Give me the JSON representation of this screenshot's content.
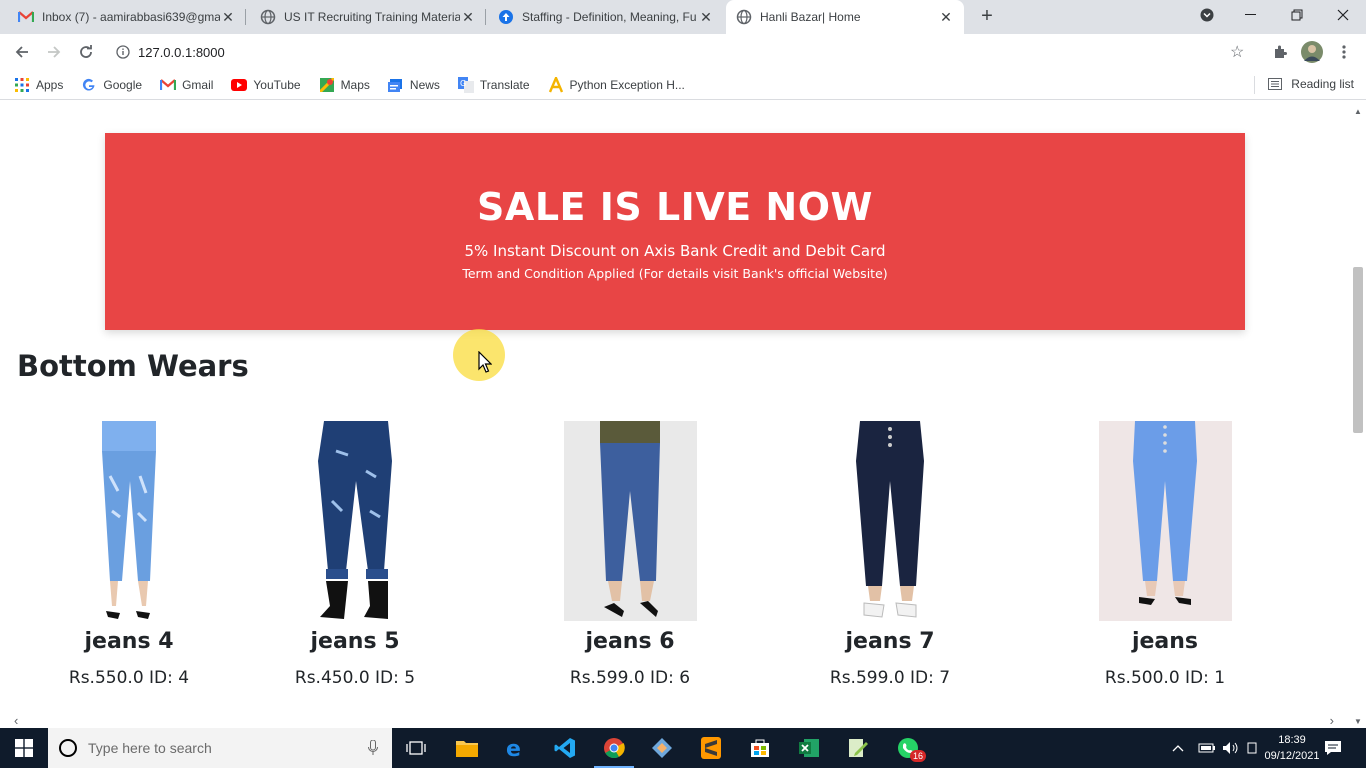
{
  "browser": {
    "tabs": [
      {
        "label": "Inbox (7) - aamirabbasi639@gma",
        "icon": "gmail-icon"
      },
      {
        "label": "US IT Recruiting Training Materia",
        "icon": "globe-icon"
      },
      {
        "label": "Staffing - Definition, Meaning, Fu",
        "icon": "upload-icon"
      },
      {
        "label": "Hanli Bazar| Home",
        "icon": "globe-icon"
      }
    ],
    "url": "127.0.0.1:8000",
    "bookmarks": [
      {
        "label": "Apps",
        "icon": "apps-grid-icon"
      },
      {
        "label": "Google",
        "icon": "google-icon"
      },
      {
        "label": "Gmail",
        "icon": "gmail-icon"
      },
      {
        "label": "YouTube",
        "icon": "youtube-icon"
      },
      {
        "label": "Maps",
        "icon": "maps-icon"
      },
      {
        "label": "News",
        "icon": "news-icon"
      },
      {
        "label": "Translate",
        "icon": "translate-icon"
      },
      {
        "label": "Python Exception H...",
        "icon": "amazon-a-icon"
      }
    ],
    "reading_list": "Reading list"
  },
  "page": {
    "banner": {
      "title": "SALE IS LIVE NOW",
      "line1": "5% Instant Discount on Axis Bank Credit and Debit Card",
      "line2": "Term and Condition Applied (For details visit Bank's official Website)",
      "color": "#e84545"
    },
    "section_title": "Bottom Wears",
    "products": [
      {
        "name": "jeans 4",
        "price": "Rs.550.0 ID: 4",
        "color": "#6a9fe0"
      },
      {
        "name": "jeans 5",
        "price": "Rs.450.0 ID: 5",
        "color": "#1f3f75"
      },
      {
        "name": "jeans 6",
        "price": "Rs.599.0 ID: 6",
        "color": "#3d5f9e"
      },
      {
        "name": "jeans 7",
        "price": "Rs.599.0 ID: 7",
        "color": "#1a2440"
      },
      {
        "name": "jeans",
        "price": "Rs.500.0 ID: 1",
        "color": "#6b9de8"
      }
    ]
  },
  "taskbar": {
    "search_placeholder": "Type here to search",
    "time": "18:39",
    "date": "09/12/2021",
    "whatsapp_badge": "16"
  }
}
